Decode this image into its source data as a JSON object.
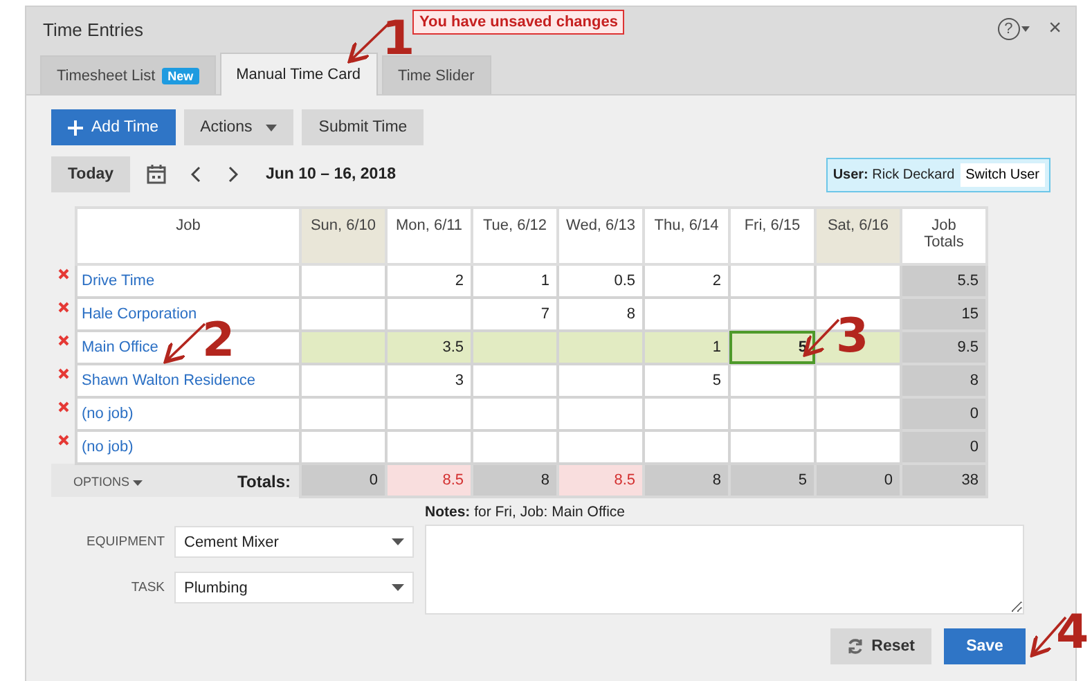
{
  "window": {
    "title": "Time Entries",
    "help_label": "?",
    "close_label": "×"
  },
  "unsaved_notice": "You have unsaved changes",
  "tabs": [
    {
      "label": "Timesheet List",
      "badge": "New",
      "selected": false
    },
    {
      "label": "Manual Time Card",
      "selected": true
    },
    {
      "label": "Time Slider",
      "selected": false
    }
  ],
  "toolbar": {
    "add_button": "Add Time",
    "actions_button": "Actions",
    "submit_button": "Submit Time"
  },
  "date_nav": {
    "today_button": "Today",
    "range": "Jun 10 – 16, 2018"
  },
  "user": {
    "label": "User:",
    "name": "Rick Deckard",
    "switch_button": "Switch User"
  },
  "grid": {
    "job_header": "Job",
    "totals_header": "Job Totals",
    "days": [
      {
        "label": "Sun, 6/10",
        "weekend": true
      },
      {
        "label": "Mon, 6/11",
        "weekend": false
      },
      {
        "label": "Tue, 6/12",
        "weekend": false
      },
      {
        "label": "Wed, 6/13",
        "weekend": false
      },
      {
        "label": "Thu, 6/14",
        "weekend": false
      },
      {
        "label": "Fri, 6/15",
        "weekend": false
      },
      {
        "label": "Sat, 6/16",
        "weekend": true
      }
    ],
    "rows": [
      {
        "job": "Drive Time",
        "cells": [
          "",
          "2",
          "1",
          "0.5",
          "2",
          "",
          ""
        ],
        "total": "5.5",
        "selected": false
      },
      {
        "job": "Hale Corporation",
        "cells": [
          "",
          "",
          "7",
          "8",
          "",
          "",
          ""
        ],
        "total": "15",
        "selected": false
      },
      {
        "job": "Main Office",
        "cells": [
          "",
          "3.5",
          "",
          "",
          "1",
          "5",
          ""
        ],
        "total": "9.5",
        "selected": true,
        "focused": [
          false,
          false,
          false,
          false,
          false,
          true,
          false
        ]
      },
      {
        "job": "Shawn Walton Residence",
        "cells": [
          "",
          "3",
          "",
          "",
          "5",
          "",
          ""
        ],
        "total": "8",
        "selected": false
      },
      {
        "job": "(no job)",
        "cells": [
          "",
          "",
          "",
          "",
          "",
          "",
          ""
        ],
        "total": "0",
        "selected": false
      },
      {
        "job": "(no job)",
        "cells": [
          "",
          "",
          "",
          "",
          "",
          "",
          ""
        ],
        "total": "0",
        "selected": false
      }
    ],
    "options_label": "OPTIONS",
    "totals_label": "Totals:",
    "day_totals": [
      {
        "value": "0",
        "over": false
      },
      {
        "value": "8.5",
        "over": true
      },
      {
        "value": "8",
        "over": false
      },
      {
        "value": "8.5",
        "over": true
      },
      {
        "value": "8",
        "over": false
      },
      {
        "value": "5",
        "over": false
      },
      {
        "value": "0",
        "over": false
      }
    ],
    "grand_total": "38"
  },
  "fields": [
    {
      "label": "EQUIPMENT",
      "value": "Cement Mixer"
    },
    {
      "label": "TASK",
      "value": "Plumbing"
    }
  ],
  "notes": {
    "label": "Notes:",
    "context": "for Fri, Job: Main Office"
  },
  "buttons": {
    "reset": "Reset",
    "save": "Save"
  },
  "annotations": [
    {
      "label": "1"
    },
    {
      "label": "2"
    },
    {
      "label": "3"
    },
    {
      "label": "4"
    }
  ]
}
